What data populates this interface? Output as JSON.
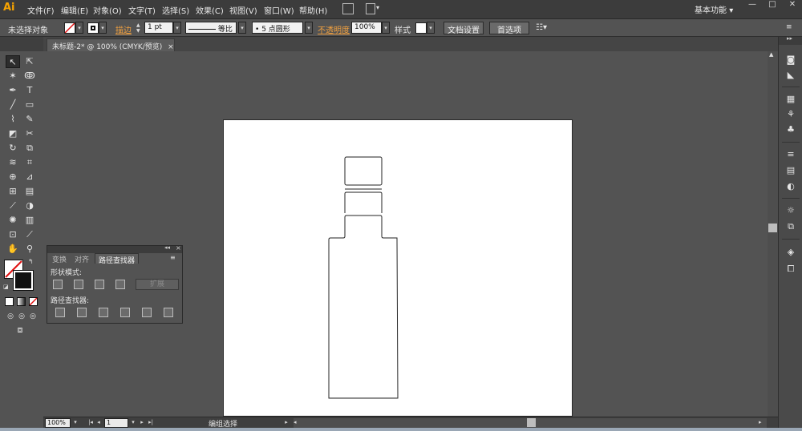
{
  "app": {
    "logo": "Ai"
  },
  "menu": [
    "文件(F)",
    "编辑(E)",
    "对象(O)",
    "文字(T)",
    "选择(S)",
    "效果(C)",
    "视图(V)",
    "窗口(W)",
    "帮助(H)"
  ],
  "workspace": {
    "label": "基本功能",
    "arrow": "▾"
  },
  "window_controls": {
    "minimize": "—",
    "maximize": "□",
    "close": "✕"
  },
  "control_bar": {
    "selection_label": "未选择对象",
    "stroke_label": "描边",
    "stroke_weight": "1 pt",
    "stroke_style_label": "等比",
    "brush_label": "5 点圆形",
    "opacity_label": "不透明度",
    "opacity_value": "100%",
    "style_label": "样式",
    "doc_setup_button": "文档设置",
    "prefs_button": "首选项"
  },
  "document_tab": {
    "title": "未标题-2* @ 100% (CMYK/预览)",
    "close": "×"
  },
  "pathfinder_panel": {
    "tabs": [
      "变换",
      "对齐",
      "路径查找器"
    ],
    "shape_modes_label": "形状模式:",
    "pathfinders_label": "路径查找器:",
    "expand_button": "扩展",
    "menu_icon": "≡"
  },
  "status_bar": {
    "zoom": "100%",
    "artboard_number": "1",
    "status_text": "编组选择"
  },
  "colors": {
    "bg": "#535353",
    "artboard": "#ffffff",
    "accent_orange": "#f7a300"
  },
  "icons": {
    "tools": [
      "selection-tool-icon",
      "direct-selection-tool-icon",
      "magic-wand-icon",
      "lasso-icon",
      "pen-icon",
      "type-icon",
      "line-icon",
      "rectangle-icon",
      "paintbrush-icon",
      "pencil-icon",
      "blob-brush-icon",
      "scissors-icon",
      "rotate-icon",
      "scale-icon",
      "warp-icon",
      "free-transform-icon",
      "shape-builder-icon",
      "perspective-icon",
      "mesh-icon",
      "gradient-icon",
      "eyedropper-icon",
      "blend-icon",
      "symbol-sprayer-icon",
      "graph-icon",
      "artboard-tool-icon",
      "slice-icon",
      "hand-icon",
      "zoom-icon"
    ]
  }
}
